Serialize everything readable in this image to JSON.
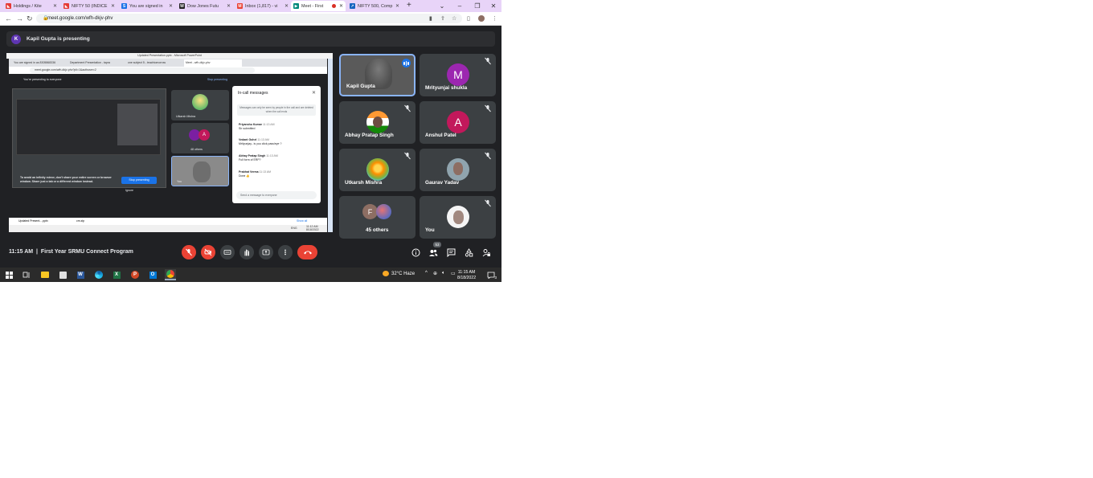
{
  "browser": {
    "tabs": [
      {
        "label": "Holdings / Kite",
        "icon_color": "#e53935",
        "active": false
      },
      {
        "label": "NIFTY 50 (INDICE",
        "icon_color": "#e53935",
        "active": false
      },
      {
        "label": "You are signed in",
        "icon_color": "#1a73e8",
        "active": false
      },
      {
        "label": "Dow Jones Futu",
        "icon_color": "#222222",
        "active": false
      },
      {
        "label": "Inbox (1,817) - vi",
        "icon_color": "#ea4335",
        "active": false
      },
      {
        "label": "Meet - First",
        "icon_color": "#00897b",
        "active": true
      },
      {
        "label": "NIFTY 500, Comp",
        "icon_color": "#1565c0",
        "active": false
      }
    ],
    "url": "meet.google.com/wfh-dkjv-phv",
    "window_controls": [
      "⌄",
      "–",
      "❐",
      "✕"
    ]
  },
  "meet": {
    "presenter_initial": "K",
    "presenting_text": "Kapil Gupta is presenting",
    "shared": {
      "ppt_title": "Updated Presentation.pptx - Microsoft PowerPoint",
      "inner_tabs": [
        "You are signed in as 8305868336",
        "Department Presentation - tapra",
        "one subject 5 - teachtomorrow",
        "Meet - wfh-dkjv-phv"
      ],
      "inner_url": "meet.google.com/wfh-dkjv-phv?pli=1&authuser=2",
      "presenting_to": "You're presenting to everyone",
      "stop_presenting": "Stop presenting",
      "warning": "To avoid an infinity mirror, don't share your entire screen or browser window. Share just a tab or a different window instead.",
      "stop_button": "Stop presenting",
      "ignore": "Ignore",
      "tile_names": [
        "Utkarsh Mishra",
        "48 others",
        "You"
      ],
      "chat_title": "In-call messages",
      "chat_info": "Messages can only be seen by people in the call and are deleted when the call ends",
      "messages": [
        {
          "name": "Priyanshu Kumar",
          "time": "11:13 AM",
          "text": "Sir submitted"
        },
        {
          "name": "Vedant Gohel",
          "time": "11:13 AM",
          "text": "Mrityunjay.. is you click pass/eye ?"
        },
        {
          "name": "Abhay Pratap Singh",
          "time": "11:13 AM",
          "text": "Full form of ERP?"
        },
        {
          "name": "Prabhat Verma",
          "time": "11:13 AM",
          "text": "Done 👍"
        }
      ],
      "chat_input": "Send a message to everyone",
      "meeting_code": "wfh-dkjv-phv",
      "download_file1": "Updated Present....pptx",
      "download_file2": "cm.zip",
      "show_all": "Show all",
      "task_lang": "ENG",
      "task_time": "11:12 AM",
      "task_date": "8/18/2022"
    },
    "participants": [
      {
        "name": "Kapil Gupta",
        "type": "video",
        "speaking": true
      },
      {
        "name": "Mrityunjai shukla",
        "type": "initial",
        "initial": "M",
        "color": "#9c27b0"
      },
      {
        "name": "Abhay Pratap Singh",
        "type": "photo"
      },
      {
        "name": "Anshul Patel",
        "type": "initial",
        "initial": "A",
        "color": "#c2185b"
      },
      {
        "name": "Utkarsh Mishra",
        "type": "photo"
      },
      {
        "name": "Gaurav Yadav",
        "type": "photo"
      },
      {
        "name": "45 others",
        "type": "group",
        "initial": "F"
      },
      {
        "name": "You",
        "type": "photo"
      }
    ],
    "time": "11:15 AM",
    "separator": "|",
    "meeting_title": "First Year SRMU Connect Program",
    "people_count": "53"
  },
  "taskbar": {
    "weather": "32°C  Haze",
    "time": "11:15 AM",
    "date": "8/18/2022",
    "notification_count": "3"
  }
}
